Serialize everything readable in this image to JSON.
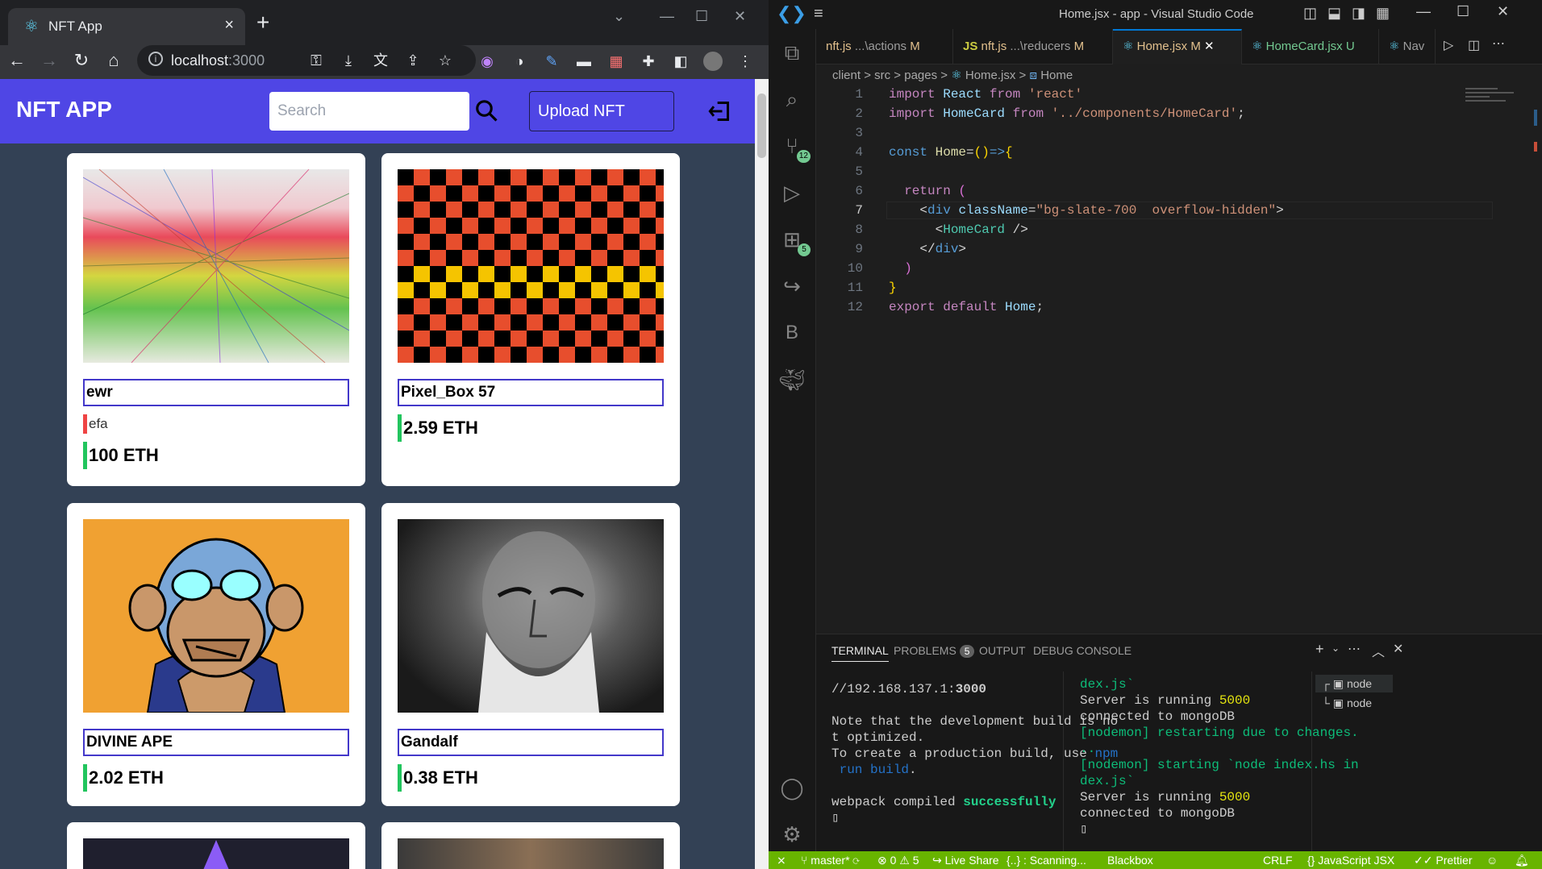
{
  "browser": {
    "tab_title": "NFT App",
    "url_host": "localhost",
    "url_port": ":3000"
  },
  "app": {
    "brand": "NFT APP",
    "search_placeholder": "Search",
    "upload_label": "Upload NFT",
    "cards": [
      {
        "name": "ewr",
        "description": "efa",
        "price": "100 ETH"
      },
      {
        "name": "Pixel_Box 57",
        "price": "2.59 ETH"
      },
      {
        "name": "DIVINE APE",
        "price": "2.02 ETH"
      },
      {
        "name": "Gandalf",
        "price": "0.38 ETH"
      }
    ]
  },
  "vscode": {
    "window_title": "Home.jsx - app - Visual Studio Code",
    "tabs": [
      {
        "label": "nft.js",
        "path": "...\\actions",
        "status": "M"
      },
      {
        "label": "nft.js",
        "path": "...\\reducers",
        "status": "M"
      },
      {
        "label": "Home.jsx",
        "status": "M"
      },
      {
        "label": "HomeCard.jsx",
        "status": "U"
      },
      {
        "label": "Nav"
      }
    ],
    "breadcrumb": [
      "client",
      "src",
      "pages",
      "Home.jsx",
      "Home"
    ],
    "badges": {
      "source_control": "12",
      "extensions": "5"
    },
    "line_numbers": [
      "1",
      "2",
      "3",
      "4",
      "5",
      "6",
      "7",
      "8",
      "9",
      "10",
      "11",
      "12"
    ],
    "panel_tabs": [
      "TERMINAL",
      "PROBLEMS",
      "OUTPUT",
      "DEBUG CONSOLE"
    ],
    "problems_count": "5",
    "terminal_left": {
      "url_prefix": "//192.168.137.1:",
      "url_port": "3000",
      "line1": "Note that the development build is no",
      "line2": "t optimized.",
      "line3_pre": "To create a production build, use ",
      "line3_npm": "npm",
      "line4": " run build",
      "line4_post": ".",
      "webpack": "webpack compiled ",
      "success": "successfully"
    },
    "terminal_right": [
      "dex.js`",
      "Server is running ",
      "5000",
      "connected to mongoDB",
      "[nodemon] restarting due to changes.",
      "..",
      "[nodemon] starting `node index.hs in",
      "dex.js`",
      "Server is running ",
      "5000",
      "connected to mongoDB"
    ],
    "terminal_list": [
      "node",
      "node"
    ],
    "status": {
      "branch": "master*",
      "errors": "0",
      "warnings": "5",
      "live_share": "Live Share",
      "scanning": "{..} : Scanning...",
      "blackbox": "Blackbox",
      "eol": "CRLF",
      "language": "JavaScript JSX",
      "prettier": "Prettier"
    },
    "colors": {
      "status_bar": "#68b400",
      "accent": "#0078d4"
    }
  }
}
